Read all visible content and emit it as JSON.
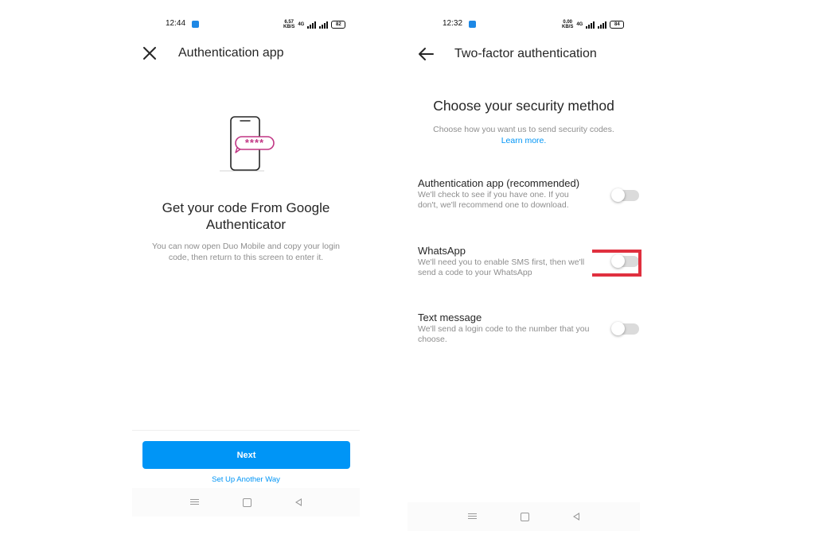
{
  "left_screen": {
    "status_bar": {
      "time": "12:44",
      "net_speed": "6.57",
      "net_unit": "KB/S",
      "network_label": "4G",
      "battery": "82"
    },
    "header": {
      "close_icon": "close-icon",
      "title": "Authentication app"
    },
    "illustration": {
      "masked_code": "****"
    },
    "heading": "Get your code From Google Authenticator",
    "description": "You can now open Duo Mobile and copy your login code, then return to this screen to enter it.",
    "next_button": "Next",
    "alt_link": "Set Up Another Way"
  },
  "right_screen": {
    "status_bar": {
      "time": "12:32",
      "net_speed": "0.00",
      "net_unit": "KB/S",
      "network_label": "4G",
      "battery": "84"
    },
    "header": {
      "back_icon": "arrow-left-icon",
      "title": "Two-factor authentication"
    },
    "heading": "Choose your security method",
    "description": "Choose how you want us to send security codes.",
    "learn_more": "Learn more.",
    "options": [
      {
        "title": "Authentication app (recommended)",
        "description": "We'll check to see if you have one. If you don't, we'll recommend one to download.",
        "enabled": false
      },
      {
        "title": "WhatsApp",
        "description": "We'll need you to enable SMS first, then we'll send a code to your WhatsApp",
        "enabled": false
      },
      {
        "title": "Text message",
        "description": "We'll send a login code to the number that you choose.",
        "enabled": false
      }
    ]
  },
  "colors": {
    "primary": "#0095f6",
    "highlight": "#e0303f",
    "illustration_accent": "#c13584",
    "app_icon": "#1e88e5"
  }
}
